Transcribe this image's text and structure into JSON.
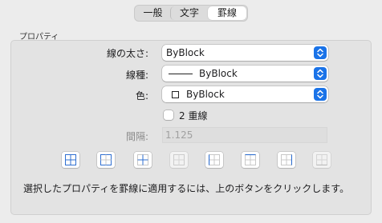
{
  "tabs": [
    {
      "label": "一般"
    },
    {
      "label": "文字"
    },
    {
      "label": "罫線"
    }
  ],
  "group_label": "プロパティ",
  "line_weight": {
    "label": "線の太さ:",
    "value": "ByBlock"
  },
  "line_type": {
    "label": "線種:",
    "value": "ByBlock"
  },
  "color": {
    "label": "色:",
    "value": "ByBlock"
  },
  "double_line": {
    "label": "2 重線",
    "checked": false
  },
  "spacing": {
    "label": "間隔:",
    "value": "1.125"
  },
  "border_buttons": [
    {
      "name": "all-borders"
    },
    {
      "name": "outside-borders"
    },
    {
      "name": "inside-borders"
    },
    {
      "name": "no-borders"
    },
    {
      "name": "left-border"
    },
    {
      "name": "top-border"
    },
    {
      "name": "right-border"
    },
    {
      "name": "bottom-border"
    }
  ],
  "footer_text": "選択したプロパティを罫線に適用するには、上のボタンをクリックします。",
  "colors": {
    "accent": "#1a73e8",
    "panel": "#e3e3e3",
    "background": "#ececec"
  }
}
